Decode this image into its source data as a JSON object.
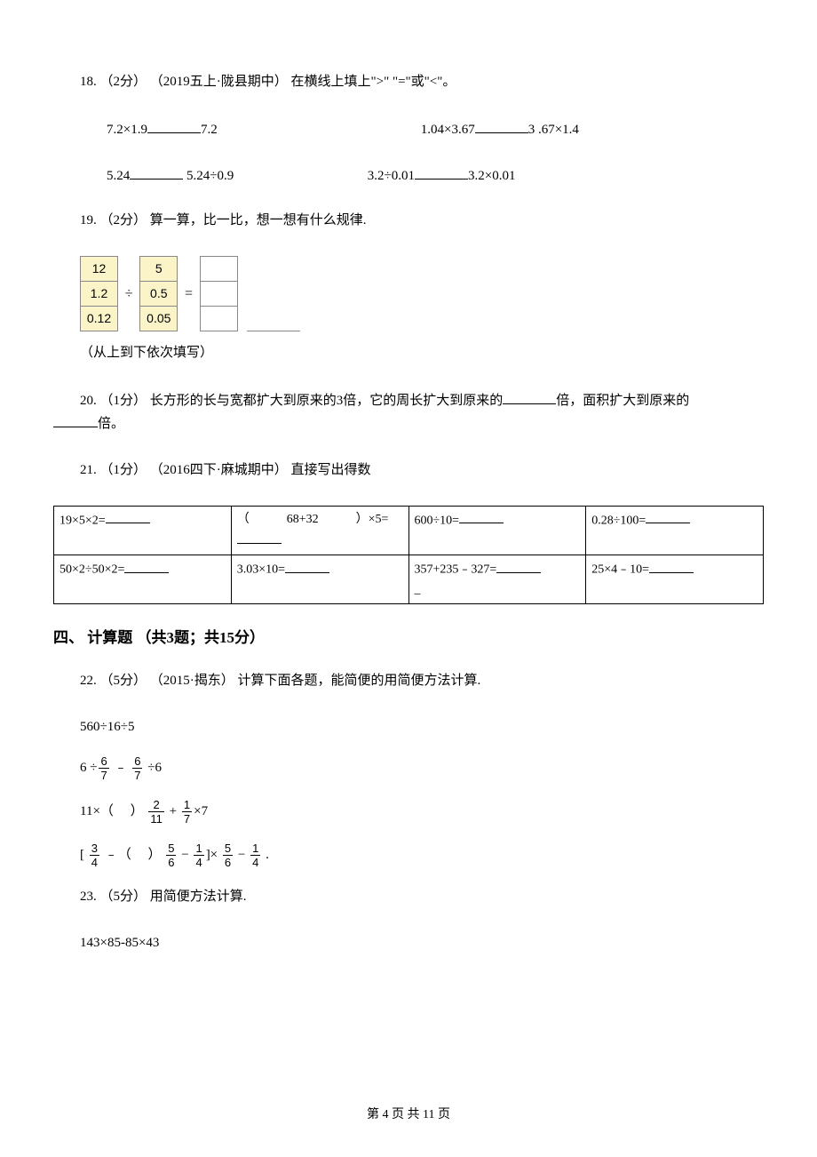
{
  "q18": {
    "label": "18.",
    "points": "（2分）",
    "source": "（2019五上·陇县期中）",
    "instruction": "在横线上填上\">\" \"=\"或\"<\"。",
    "e1a": "7.2×1.9",
    "e1b": "7.2",
    "e2a": "1.04×3.67",
    "e2b": "3 .67×1.4",
    "e3a": "5.24",
    "e3b": "5.24÷0.9",
    "e4a": "3.2÷0.01",
    "e4b": "3.2×0.01"
  },
  "q19": {
    "label": "19.",
    "points": "（2分）",
    "instruction": "算一算，比一比，想一想有什么规律.",
    "col1": [
      "12",
      "1.2",
      "0.12"
    ],
    "op1": "÷",
    "col2": [
      "5",
      "0.5",
      "0.05"
    ],
    "op2": "=",
    "col3": [
      "",
      "",
      ""
    ],
    "note": "（从上到下依次填写）"
  },
  "q20": {
    "label": "20.",
    "points": "（1分）",
    "text_a": "长方形的长与宽都扩大到原来的3倍，它的周长扩大到原来的",
    "text_b": "倍，面积扩大到原来的",
    "text_c": "倍。"
  },
  "q21": {
    "label": "21.",
    "points": "（1分）",
    "source": "（2016四下·麻城期中）",
    "instruction": "直接写出得数",
    "cells": [
      [
        "19×5×2=",
        "（　　　68+32　　　）×5=",
        "600÷10=",
        "0.28÷100="
      ],
      [
        "50×2÷50×2=",
        "3.03×10=",
        "357+235﹣327=",
        "25×4﹣10="
      ]
    ]
  },
  "section4": {
    "title": "四、 计算题 （共3题；共15分）"
  },
  "q22": {
    "label": "22.",
    "points": "（5分）",
    "source": "（2015·揭东）",
    "instruction": "计算下面各题，能简便的用简便方法计算.",
    "line1": "560÷16÷5",
    "line2_a": "6 ÷",
    "line2_b": " ﹣ ",
    "line2_c": " ÷6",
    "line3_a": "11×（　 ）",
    "line3_b": "×7",
    "line4_a": "[ ",
    "line4_b": " ﹣（　 ）",
    "line4_c": "]× ",
    "line4_d": " ."
  },
  "q23": {
    "label": "23.",
    "points": "（5分）",
    "instruction": "用简便方法计算.",
    "line1": "143×85-85×43"
  },
  "footer": "第 4 页 共 11 页"
}
